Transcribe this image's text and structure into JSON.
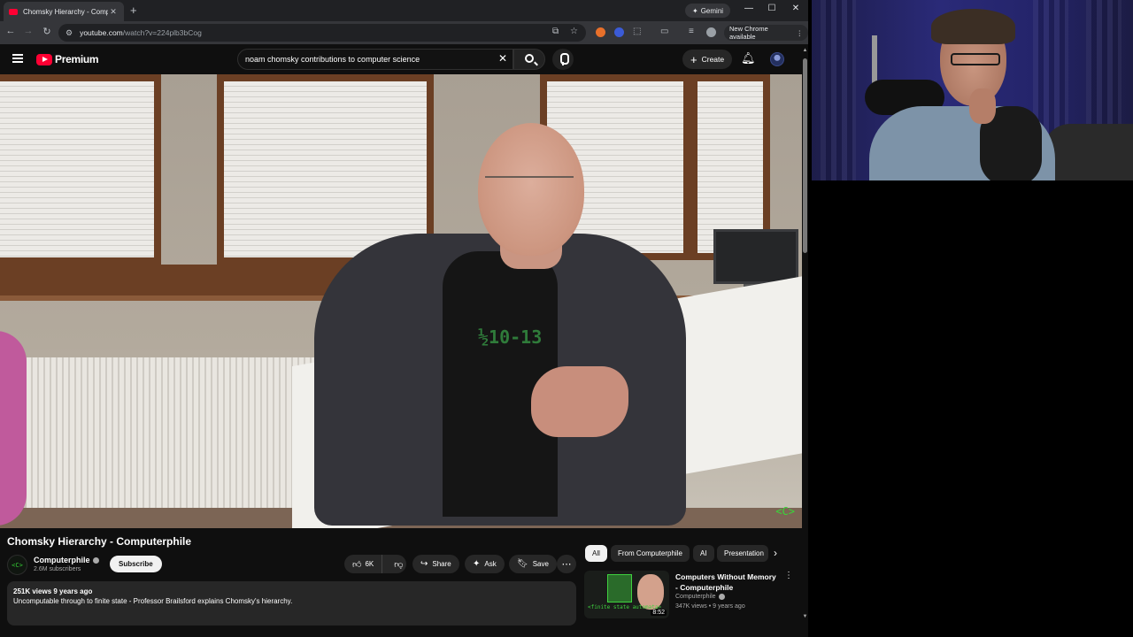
{
  "browser": {
    "tab_title": "Chomsky Hierarchy - Computerphile",
    "tab_close": "✕",
    "new_tab": "+",
    "gemini_label": "Gemini",
    "window_controls": {
      "minimize": "—",
      "maximize": "☐",
      "close": "✕"
    },
    "url_host": "youtube.com",
    "url_path": "/watch?v=224plb3bCog",
    "update_label": "New Chrome available",
    "icons": [
      "back-icon",
      "forward-icon",
      "reload-icon",
      "site-settings-icon",
      "install-icon",
      "bookmark-star-icon",
      "extensions-icon",
      "profile-icon",
      "menu-icon"
    ]
  },
  "header": {
    "logo_text": "Premium",
    "search_value": "noam chomsky contributions to computer science",
    "create_label": "Create"
  },
  "video": {
    "shirt_text": "½10-13",
    "watermark": "<C>"
  },
  "watch": {
    "title": "Chomsky Hierarchy - Computerphile",
    "channel_avatar_text": "<C>",
    "channel_name": "Computerphile",
    "subscribers": "2.6M subscribers",
    "subscribe_label": "Subscribe",
    "like_count": "6K",
    "share_label": "Share",
    "ask_label": "Ask",
    "save_label": "Save",
    "description": {
      "meta": "251K views  9 years ago",
      "text": "Uncomputable through to finite state - Professor Brailsford explains Chomsky's hierarchy."
    }
  },
  "sidebar": {
    "chips": [
      "All",
      "From Computerphile",
      "AI",
      "Presentation"
    ],
    "recommendation": {
      "title": "Computers Without Memory - Computerphile",
      "channel": "Computerphile",
      "meta": "347K views • 9 years ago",
      "duration": "8:52",
      "thumb_text": "<finite state automata>"
    }
  },
  "colors": {
    "yt_red": "#ff0033",
    "page_bg": "#0f0f0f",
    "pill_bg": "#272727",
    "computerphile_green": "#38d838"
  }
}
